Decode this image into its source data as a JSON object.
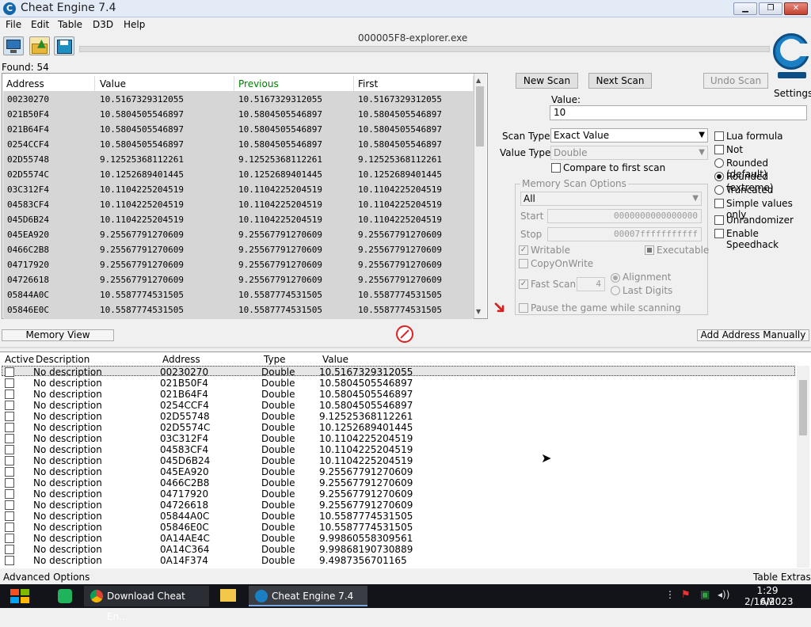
{
  "window": {
    "title": "Cheat Engine 7.4",
    "process": "000005F8-explorer.exe"
  },
  "menu": [
    "File",
    "Edit",
    "Table",
    "D3D",
    "Help"
  ],
  "found_label": "Found: 54",
  "scan_list": {
    "headers": [
      "Address",
      "Value",
      "Previous",
      "First"
    ],
    "rows": [
      [
        "00230270",
        "10.5167329312055",
        "10.5167329312055",
        "10.5167329312055"
      ],
      [
        "021B50F4",
        "10.5804505546897",
        "10.5804505546897",
        "10.5804505546897"
      ],
      [
        "021B64F4",
        "10.5804505546897",
        "10.5804505546897",
        "10.5804505546897"
      ],
      [
        "0254CCF4",
        "10.5804505546897",
        "10.5804505546897",
        "10.5804505546897"
      ],
      [
        "02D55748",
        "9.12525368112261",
        "9.12525368112261",
        "9.12525368112261"
      ],
      [
        "02D5574C",
        "10.1252689401445",
        "10.1252689401445",
        "10.1252689401445"
      ],
      [
        "03C312F4",
        "10.1104225204519",
        "10.1104225204519",
        "10.1104225204519"
      ],
      [
        "04583CF4",
        "10.1104225204519",
        "10.1104225204519",
        "10.1104225204519"
      ],
      [
        "045D6B24",
        "10.1104225204519",
        "10.1104225204519",
        "10.1104225204519"
      ],
      [
        "045EA920",
        "9.25567791270609",
        "9.25567791270609",
        "9.25567791270609"
      ],
      [
        "0466C2B8",
        "9.25567791270609",
        "9.25567791270609",
        "9.25567791270609"
      ],
      [
        "04717920",
        "9.25567791270609",
        "9.25567791270609",
        "9.25567791270609"
      ],
      [
        "04726618",
        "9.25567791270609",
        "9.25567791270609",
        "9.25567791270609"
      ],
      [
        "05844A0C",
        "10.5587774531505",
        "10.5587774531505",
        "10.5587774531505"
      ],
      [
        "05846E0C",
        "10.5587774531505",
        "10.5587774531505",
        "10.5587774531505"
      ]
    ]
  },
  "buttons": {
    "new_scan": "New Scan",
    "next_scan": "Next Scan",
    "undo_scan": "Undo Scan",
    "settings": "Settings",
    "memory_view": "Memory View",
    "add_address": "Add Address Manually"
  },
  "scan": {
    "value_label": "Value:",
    "value": "10",
    "scan_type_label": "Scan Type",
    "scan_type": "Exact Value",
    "value_type_label": "Value Type",
    "value_type": "Double",
    "compare_first": "Compare to first scan"
  },
  "options": {
    "lua_formula": "Lua formula",
    "not": "Not",
    "rounded_default": "Rounded (default)",
    "rounded_extreme": "Rounded (extreme)",
    "truncated": "Truncated",
    "simple_values": "Simple values only",
    "unrandomizer": "Unrandomizer",
    "speedhack": "Enable Speedhack"
  },
  "memory_options": {
    "title": "Memory Scan Options",
    "region": "All",
    "start_label": "Start",
    "start": "0000000000000000",
    "stop_label": "Stop",
    "stop": "00007fffffffffff",
    "writable": "Writable",
    "executable": "Executable",
    "copy_on_write": "CopyOnWrite",
    "fast_scan": "Fast Scan",
    "fast_scan_value": "4",
    "alignment": "Alignment",
    "last_digits": "Last Digits",
    "pause_game": "Pause the game while scanning"
  },
  "address_list": {
    "headers": [
      "Active",
      "Description",
      "Address",
      "Type",
      "Value"
    ],
    "rows": [
      [
        "No description",
        "00230270",
        "Double",
        "10.5167329312055"
      ],
      [
        "No description",
        "021B50F4",
        "Double",
        "10.5804505546897"
      ],
      [
        "No description",
        "021B64F4",
        "Double",
        "10.5804505546897"
      ],
      [
        "No description",
        "0254CCF4",
        "Double",
        "10.5804505546897"
      ],
      [
        "No description",
        "02D55748",
        "Double",
        "9.12525368112261"
      ],
      [
        "No description",
        "02D5574C",
        "Double",
        "10.1252689401445"
      ],
      [
        "No description",
        "03C312F4",
        "Double",
        "10.1104225204519"
      ],
      [
        "No description",
        "04583CF4",
        "Double",
        "10.1104225204519"
      ],
      [
        "No description",
        "045D6B24",
        "Double",
        "10.1104225204519"
      ],
      [
        "No description",
        "045EA920",
        "Double",
        "9.25567791270609"
      ],
      [
        "No description",
        "0466C2B8",
        "Double",
        "9.25567791270609"
      ],
      [
        "No description",
        "04717920",
        "Double",
        "9.25567791270609"
      ],
      [
        "No description",
        "04726618",
        "Double",
        "9.25567791270609"
      ],
      [
        "No description",
        "05844A0C",
        "Double",
        "10.5587774531505"
      ],
      [
        "No description",
        "05846E0C",
        "Double",
        "10.5587774531505"
      ],
      [
        "No description",
        "0A14AE4C",
        "Double",
        "9.99860558309561"
      ],
      [
        "No description",
        "0A14C364",
        "Double",
        "9.99868190730889"
      ],
      [
        "No description",
        "0A14F374",
        "Double",
        "9.4987356701165"
      ]
    ]
  },
  "footer": {
    "advanced": "Advanced Options",
    "extras": "Table Extras"
  },
  "taskbar": {
    "app1": "Download Cheat En...",
    "app2": "Cheat Engine 7.4",
    "time": "1:29 AM",
    "date": "2/16/2023"
  },
  "colors": {
    "previous_header": "#008000",
    "titlebar": "#e3ebf7",
    "taskbar": "#121419"
  }
}
